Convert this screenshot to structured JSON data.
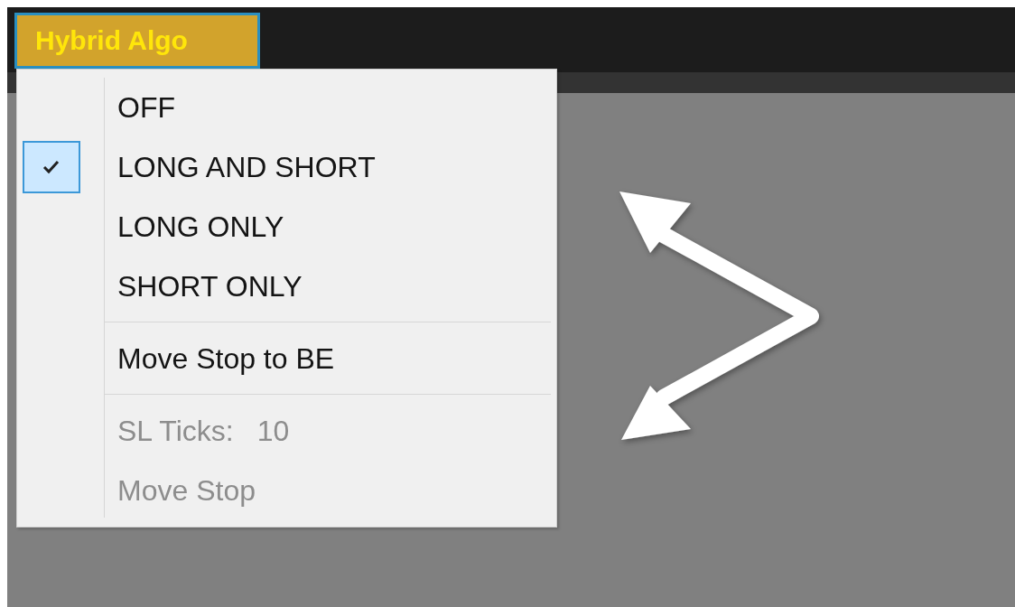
{
  "toolbar": {
    "button": {
      "label": "Hybrid Algo",
      "open": true
    }
  },
  "menu": {
    "items": [
      {
        "kind": "item",
        "label": "OFF",
        "checked": false,
        "disabled": false
      },
      {
        "kind": "item",
        "label": "LONG AND SHORT",
        "checked": true,
        "disabled": false
      },
      {
        "kind": "item",
        "label": "LONG ONLY",
        "checked": false,
        "disabled": false
      },
      {
        "kind": "item",
        "label": "SHORT ONLY",
        "checked": false,
        "disabled": false
      },
      {
        "kind": "separator"
      },
      {
        "kind": "item",
        "label": "Move Stop to BE",
        "checked": false,
        "disabled": false
      },
      {
        "kind": "separator"
      },
      {
        "kind": "item",
        "label": "SL Ticks:",
        "value": "10",
        "checked": false,
        "disabled": true
      },
      {
        "kind": "item",
        "label": "Move Stop",
        "checked": false,
        "disabled": true
      }
    ]
  }
}
